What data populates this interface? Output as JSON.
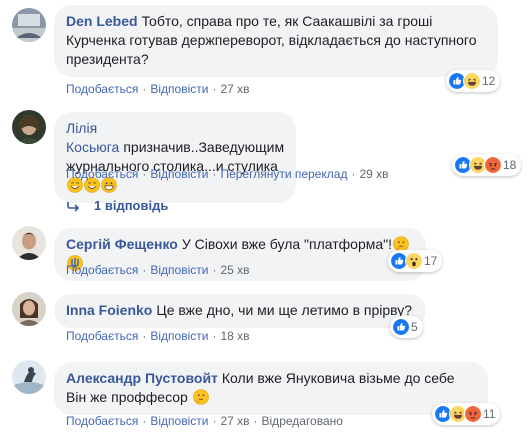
{
  "colors": {
    "bubble": "#f2f3f5",
    "author": "#385898",
    "action_link": "#4267b2",
    "like_blue": "#1877f2",
    "love_red": "#f33e58",
    "emoji_yellow": "#fcd661"
  },
  "comments": [
    {
      "author": "Den Lebed",
      "text": "Тобто, справа про те, як Саакашвілі за гроші Курченка готував держпереворот, відкладається до наступного президента?",
      "like": "Подобається",
      "reply": "Відповісти",
      "time": "27 хв",
      "reaction_count": "12",
      "reactions": [
        "like-icon",
        "laugh-icon"
      ]
    },
    {
      "author": "Лілія Косьюга",
      "text": "призначив..Заведующим журнального столика...и стулика",
      "like": "Подобається",
      "reply": "Відповісти",
      "translate": "Переглянути переклад",
      "time": "29 хв",
      "reaction_count": "18",
      "reactions": [
        "like-icon",
        "laugh-icon",
        "angry-icon"
      ],
      "replies_label": "1 відповідь"
    },
    {
      "author": "Сергій Фещенко",
      "text": "У Сівохи вже була \"платформа\"!",
      "like": "Подобається",
      "reply": "Відповісти",
      "time": "25 хв",
      "reaction_count": "17",
      "reactions": [
        "like-icon",
        "wow-icon"
      ]
    },
    {
      "author": "Inna Foienko",
      "text": "Це вже дно, чи ми ще летимо в прірву?",
      "like": "Подобається",
      "reply": "Відповісти",
      "time": "18 хв",
      "reaction_count": "5",
      "reactions": [
        "like-icon"
      ]
    },
    {
      "author": "Александр Пустовойт",
      "text": "Коли вже Януковича візьме до себе Він же проффесор",
      "like": "Подобається",
      "reply": "Відповісти",
      "time": "27 хв",
      "edited": "Відредаговано",
      "reaction_count": "11",
      "reactions": [
        "like-icon",
        "laugh-icon",
        "angry-icon"
      ]
    }
  ]
}
